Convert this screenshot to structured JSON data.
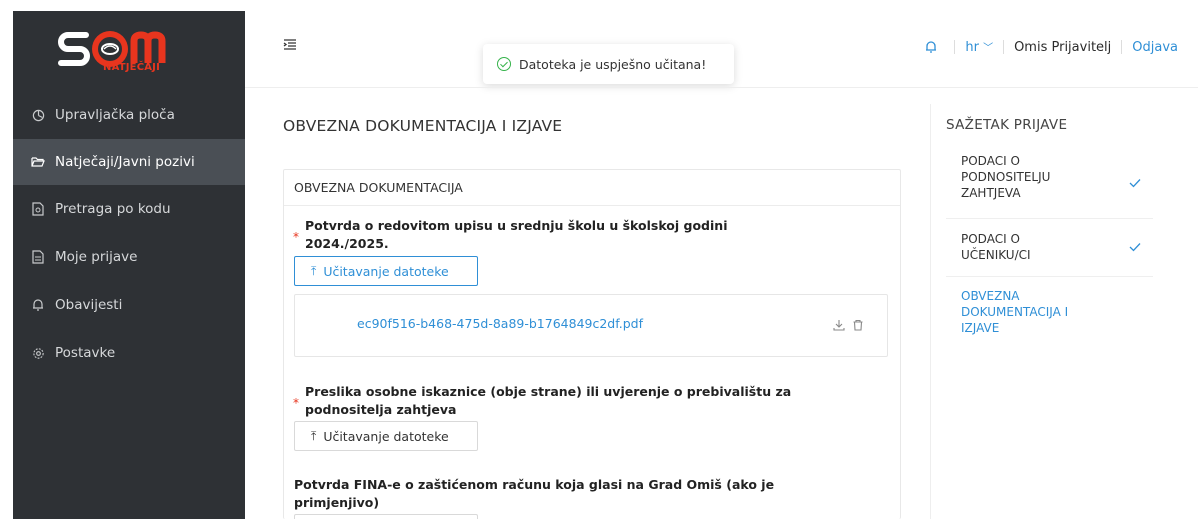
{
  "brand": {
    "logo_text": "NATJEČAJI",
    "logo_color": "#e8351e",
    "letters": "S   M"
  },
  "sidebar": {
    "items": [
      {
        "label": "Upravljačka ploča",
        "icon": "dashboard-icon"
      },
      {
        "label": "Natječaji/Javni pozivi",
        "icon": "folder-open-icon",
        "active": true
      },
      {
        "label": "Pretraga po kodu",
        "icon": "file-search-icon"
      },
      {
        "label": "Moje prijave",
        "icon": "document-icon"
      },
      {
        "label": "Obavijesti",
        "icon": "bell-icon"
      },
      {
        "label": "Postavke",
        "icon": "gear-icon"
      }
    ]
  },
  "header": {
    "toast": "Datoteka je uspješno učitana!",
    "language": "hr",
    "user": "Omis Prijavitelj",
    "logout": "Odjava"
  },
  "main": {
    "title": "OBVEZNA DOKUMENTACIJA I IZJAVE",
    "card_title": "OBVEZNA DOKUMENTACIJA",
    "fields": [
      {
        "label_line1": "Potvrda o redovitom upisu u srednju školu u školskoj godini",
        "label_line2": "2024./2025.",
        "required": true,
        "button": "Učitavanje datoteke",
        "file": "ec90f516-b468-475d-8a89-b1764849c2df.pdf"
      },
      {
        "label_line1": "Preslika osobne iskaznice (obje strane) ili uvjerenje o prebivalištu za",
        "label_line2": "podnositelja zahtjeva",
        "required": true,
        "button": "Učitavanje datoteke"
      },
      {
        "label_line1": "Potvrda FINA-e o zaštićenom računu koja glasi na Grad Omiš (ako je",
        "label_line2": "primjenjivo)",
        "required": false
      }
    ]
  },
  "summary": {
    "title": "SAŽETAK PRIJAVE",
    "items": [
      {
        "line1": "PODACI O",
        "line2": "PODNOSITELJU",
        "line3": "ZAHTJEVA",
        "done": true
      },
      {
        "line1": "PODACI O",
        "line2": "UČENIKU/CI",
        "done": true
      },
      {
        "line1": "OBVEZNA",
        "line2": "DOKUMENTACIJA I",
        "line3": "IZJAVE",
        "active": true
      }
    ]
  },
  "colors": {
    "accent": "#2f8fd6",
    "sidebar_bg": "#2e3135",
    "sidebar_active": "#4a4f55",
    "success": "#35b34a",
    "required": "#e8351e"
  }
}
